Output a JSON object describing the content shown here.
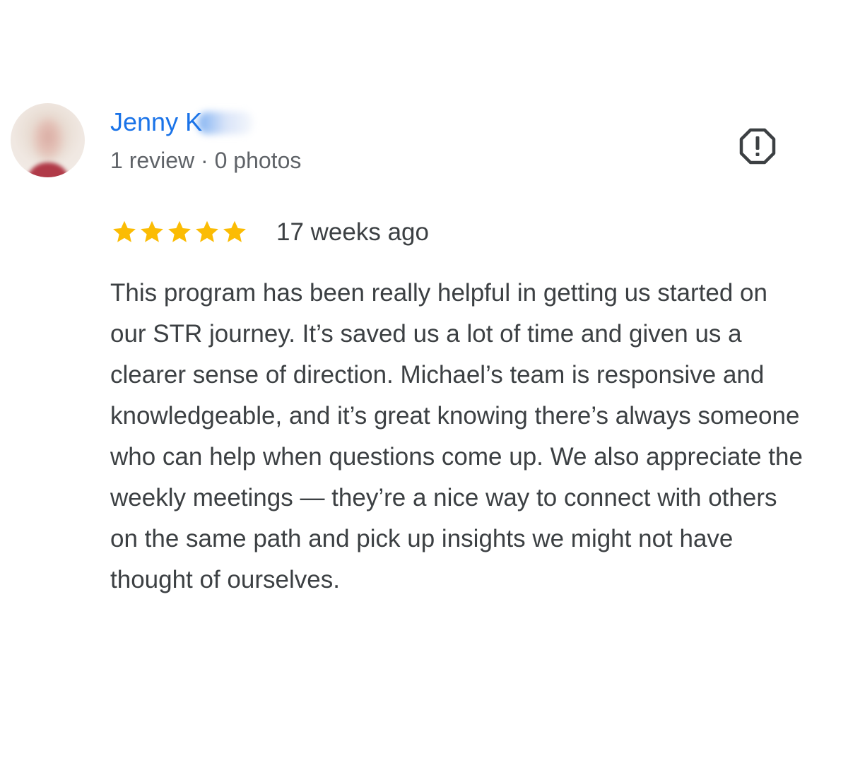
{
  "reviewer": {
    "name": "Jenny K",
    "meta": "1 review · 0 photos"
  },
  "review": {
    "rating": 5,
    "rating_max": 5,
    "date": "17 weeks ago",
    "text": "This program has been really helpful in getting us started on our STR journey. It’s saved us a lot of time and given us a clearer sense of direction. Michael’s team is responsive and knowledgeable, and it’s great knowing there’s always someone who can help when questions come up. We also appreciate the weekly meetings — they’re a nice way to connect with others on the same path and pick up insights we might not have thought of ourselves."
  },
  "icons": {
    "flag": "report-flag-icon",
    "star": "star-icon"
  },
  "colors": {
    "name_link": "#1a73e8",
    "meta_text": "#5f6368",
    "body_text": "#3c4043",
    "star": "#fbbc04",
    "flag": "#3c4043"
  }
}
